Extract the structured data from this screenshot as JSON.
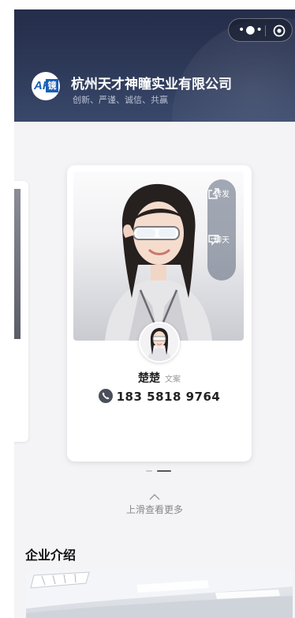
{
  "header": {
    "company_name": "杭州天才神瞳实业有限公司",
    "slogan": "创新、严谨、诚信、共赢",
    "logo": {
      "left": "AK",
      "right": "镜"
    }
  },
  "capsule": {
    "more_icon": "more-dots-icon",
    "close_icon": "target-circle-icon"
  },
  "card": {
    "actions": [
      {
        "label": "转发",
        "icon": "share-icon"
      },
      {
        "label": "聊天",
        "icon": "chat-icon"
      }
    ],
    "name": "楚楚",
    "title": "文案",
    "phone": "183 5818 9764"
  },
  "swipe_hint": "上滑查看更多",
  "intro": {
    "title": "企业介绍"
  },
  "colors": {
    "header_bg": "#2e3a59",
    "accent": "#1a5fb4"
  }
}
